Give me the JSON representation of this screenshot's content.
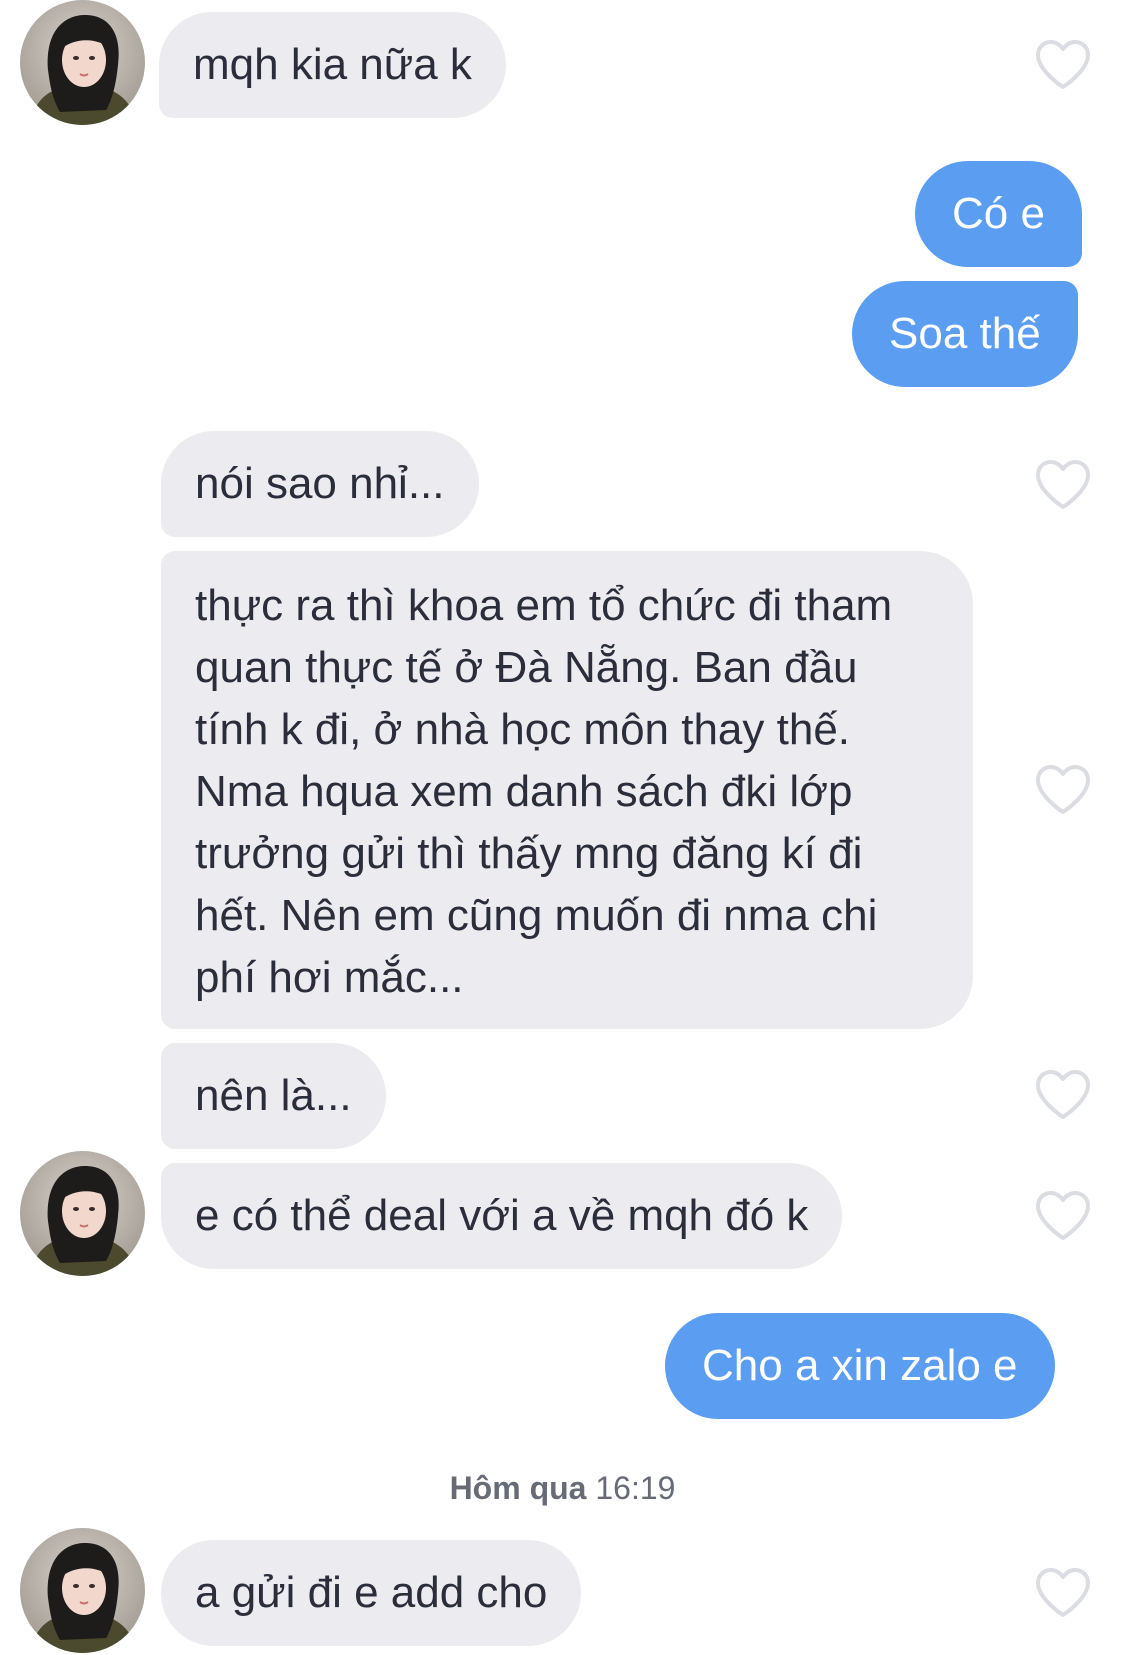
{
  "messages": [
    {
      "text": "mqh kia nữa k",
      "direction": "incoming"
    },
    {
      "text": "Có e",
      "direction": "outgoing"
    },
    {
      "text": "Soa thế",
      "direction": "outgoing"
    },
    {
      "text": "nói sao nhỉ...",
      "direction": "incoming"
    },
    {
      "text": "thực ra thì khoa em tổ chức đi tham quan thực tế ở Đà Nẵng. Ban đầu tính k đi, ở nhà học môn thay thế. Nma hqua xem danh sách đki lớp trưởng gửi thì thấy mng đăng kí đi hết. Nên em cũng muốn đi nma chi phí hơi mắc...",
      "direction": "incoming"
    },
    {
      "text": "nên là...",
      "direction": "incoming"
    },
    {
      "text": "e có thể deal với a về mqh đó k",
      "direction": "incoming"
    },
    {
      "text": "Cho a xin zalo e",
      "direction": "outgoing"
    },
    {
      "text": "a gửi đi e add cho",
      "direction": "incoming"
    }
  ],
  "timestamp": {
    "day": "Hôm qua",
    "time": "16:19"
  },
  "colors": {
    "incoming_bubble": "#ececf0",
    "incoming_text": "#2b2d3b",
    "outgoing_bubble": "#5b9ef1",
    "outgoing_text": "#ffffff",
    "heart_outline": "#dcdde2"
  },
  "icons": {
    "like": "heart-outline-icon",
    "avatar": "user-avatar"
  }
}
